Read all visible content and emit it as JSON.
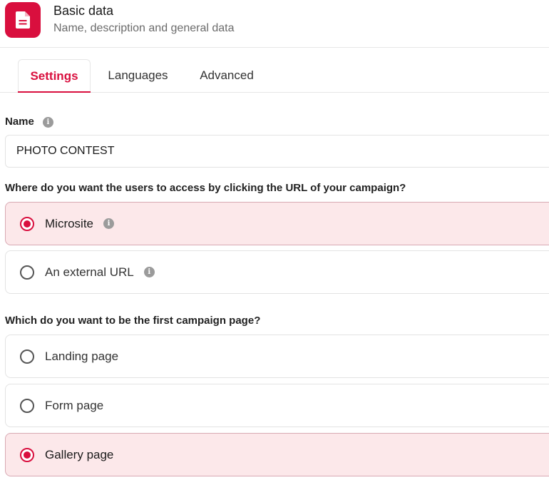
{
  "header": {
    "title": "Basic data",
    "subtitle": "Name, description and general data",
    "icon": "document-icon",
    "accent_color": "#d90f3e"
  },
  "tabs": [
    {
      "label": "Settings",
      "active": true
    },
    {
      "label": "Languages",
      "active": false
    },
    {
      "label": "Advanced",
      "active": false
    }
  ],
  "name_field": {
    "label": "Name",
    "value": "PHOTO CONTEST"
  },
  "access_question": {
    "label": "Where do you want the users to access by clicking the URL of your campaign?",
    "options": [
      {
        "label": "Microsite",
        "selected": true
      },
      {
        "label": "An external URL",
        "selected": false
      }
    ]
  },
  "first_page_question": {
    "label": "Which do you want to be the first campaign page?",
    "options": [
      {
        "label": "Landing page",
        "selected": false
      },
      {
        "label": "Form page",
        "selected": false
      },
      {
        "label": "Gallery page",
        "selected": true
      }
    ]
  }
}
